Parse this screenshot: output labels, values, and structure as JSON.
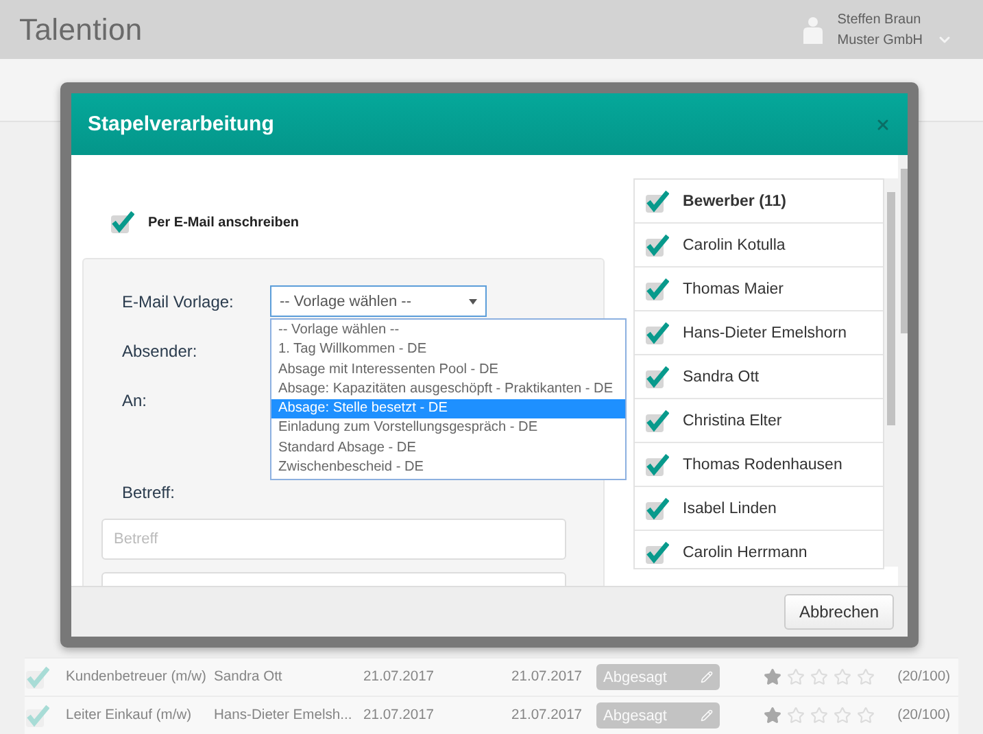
{
  "app": {
    "logo": "Talention",
    "user": {
      "name": "Steffen Braun",
      "company": "Muster GmbH"
    }
  },
  "background_table": {
    "rows": [
      {
        "position": "Kundenbetreuer (m/w)",
        "applicant": "Sandra Ott",
        "date_1": "21.07.2017",
        "date_2": "21.07.2017",
        "status": "Abgesagt",
        "stars": 1,
        "score": "(20/100)",
        "checked": true
      },
      {
        "position": "Leiter Einkauf (m/w)",
        "applicant": "Hans-Dieter Emelsh...",
        "date_1": "21.07.2017",
        "date_2": "21.07.2017",
        "status": "Abgesagt",
        "stars": 1,
        "score": "(20/100)",
        "checked": true
      }
    ]
  },
  "dialog": {
    "title": "Stapelverarbeitung",
    "email_option": {
      "label": "Per E-Mail anschreiben",
      "checked": true
    },
    "form": {
      "template_label": "E-Mail Vorlage:",
      "template_value": "-- Vorlage wählen --",
      "template_options": [
        {
          "label": "-- Vorlage wählen --",
          "selected": false
        },
        {
          "label": "1. Tag Willkommen - DE",
          "selected": false
        },
        {
          "label": "Absage mit Interessenten Pool - DE",
          "selected": false
        },
        {
          "label": "Absage: Kapazitäten ausgeschöpft - Praktikanten - DE",
          "selected": false
        },
        {
          "label": "Absage: Stelle besetzt - DE",
          "selected": true
        },
        {
          "label": "Einladung zum Vorstellungsgespräch - DE",
          "selected": false
        },
        {
          "label": "Standard Absage - DE",
          "selected": false
        },
        {
          "label": "Zwischenbescheid - DE",
          "selected": false
        }
      ],
      "sender_label": "Absender:",
      "to_label": "An:",
      "subject_label": "Betreff:",
      "subject_placeholder": "Betreff"
    },
    "recipients": [
      {
        "name": "Bewerber (11)",
        "kind": "header",
        "checked": true
      },
      {
        "name": "Carolin Kotulla",
        "kind": "person",
        "checked": true
      },
      {
        "name": "Thomas Maier",
        "kind": "person",
        "checked": true
      },
      {
        "name": "Hans-Dieter Emelshorn",
        "kind": "person",
        "checked": true
      },
      {
        "name": "Sandra Ott",
        "kind": "person",
        "checked": true
      },
      {
        "name": "Christina Elter",
        "kind": "person",
        "checked": true
      },
      {
        "name": "Thomas Rodenhausen",
        "kind": "person",
        "checked": true
      },
      {
        "name": "Isabel Linden",
        "kind": "person",
        "checked": true
      },
      {
        "name": "Carolin Herrmann",
        "kind": "person",
        "checked": true
      }
    ],
    "buttons": [
      {
        "label": "Abbrechen"
      }
    ]
  }
}
